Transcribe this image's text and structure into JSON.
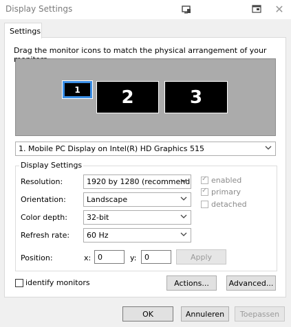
{
  "window": {
    "title": "Display Settings"
  },
  "tabs": [
    {
      "label": "Settings"
    }
  ],
  "instruction": "Drag the monitor icons to match the physical arrangement of your monitors.",
  "monitors": [
    {
      "label": "1"
    },
    {
      "label": "2"
    },
    {
      "label": "3"
    }
  ],
  "display_select": {
    "value": "1. Mobile PC Display on Intel(R) HD Graphics 515"
  },
  "group": {
    "title": "Display Settings",
    "resolution": {
      "label": "Resolution:",
      "value": "1920 by 1280  (recommend"
    },
    "orientation": {
      "label": "Orientation:",
      "value": "Landscape"
    },
    "color_depth": {
      "label": "Color depth:",
      "value": "32-bit"
    },
    "refresh_rate": {
      "label": "Refresh rate:",
      "value": "60 Hz"
    },
    "checks": {
      "enabled": {
        "label": "enabled",
        "checked": true
      },
      "primary": {
        "label": "primary",
        "checked": true
      },
      "detached": {
        "label": "detached",
        "checked": false
      }
    },
    "position": {
      "label": "Position:",
      "x_label": "x:",
      "x_value": "0",
      "y_label": "y:",
      "y_value": "0",
      "apply_label": "Apply"
    }
  },
  "identify": {
    "label": "identify monitors"
  },
  "buttons": {
    "actions": "Actions...",
    "advanced": "Advanced...",
    "ok": "OK",
    "cancel": "Annuleren",
    "apply": "Toepassen"
  },
  "icons": {
    "app": "display-settings-app-icon",
    "restore": "restore-window-icon",
    "close": "close-icon",
    "dropdown": "chevron-down-icon"
  },
  "colors": {
    "selected_monitor_border": "#3a8ee6",
    "arrangement_bg": "#ababab",
    "monitor_bg": "#000000"
  }
}
